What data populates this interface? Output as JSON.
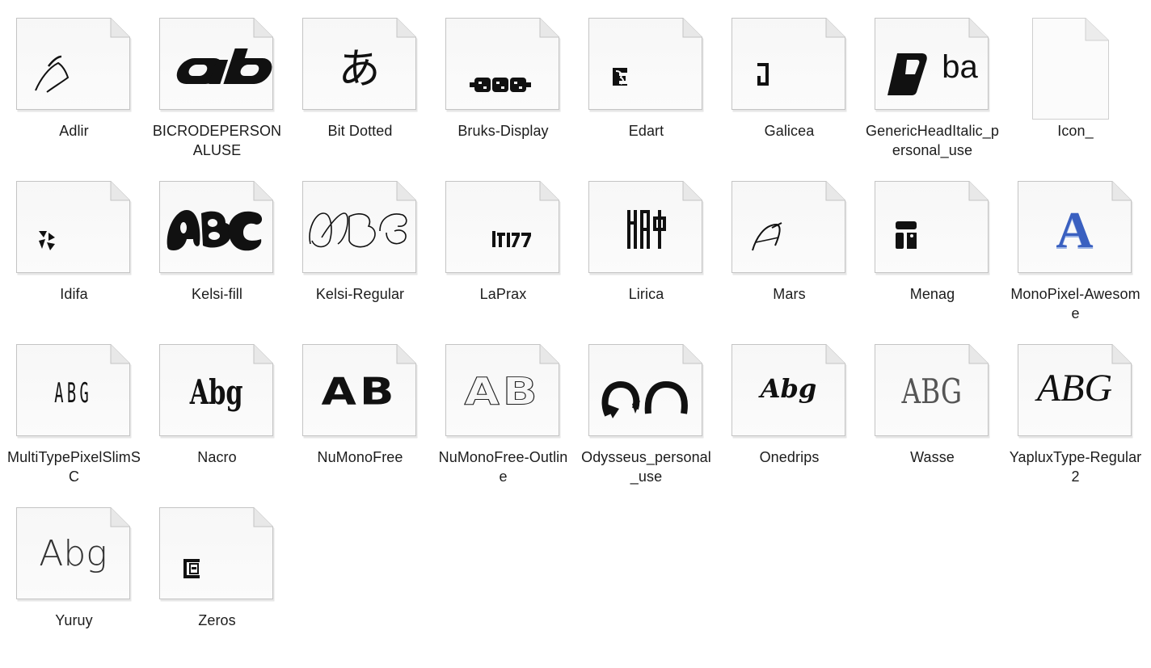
{
  "files": [
    {
      "name": "Adlir",
      "icon": "font-preview-adlir-icon"
    },
    {
      "name": "BICRODEPERSONALUSE",
      "icon": "font-preview-bicro-icon"
    },
    {
      "name": "Bit Dotted",
      "icon": "font-preview-bit-dotted-icon",
      "preview": "あ"
    },
    {
      "name": "Bruks-Display",
      "icon": "font-preview-bruks-icon"
    },
    {
      "name": "Edart",
      "icon": "font-preview-edart-icon"
    },
    {
      "name": "Galicea",
      "icon": "font-preview-galicea-icon"
    },
    {
      "name": "GenericHeadItalic_personal_use",
      "icon": "font-preview-generichead-icon",
      "preview": "ba"
    },
    {
      "name": "Icon_",
      "icon": "blank-document-icon"
    },
    {
      "name": "Idifa",
      "icon": "font-preview-idifa-icon"
    },
    {
      "name": "Kelsi-fill",
      "icon": "font-preview-kelsi-fill-icon"
    },
    {
      "name": "Kelsi-Regular",
      "icon": "font-preview-kelsi-regular-icon"
    },
    {
      "name": "LaPrax",
      "icon": "font-preview-laprax-icon"
    },
    {
      "name": "Lirica",
      "icon": "font-preview-lirica-icon"
    },
    {
      "name": "Mars",
      "icon": "font-preview-mars-icon"
    },
    {
      "name": "Menag",
      "icon": "font-preview-menag-icon"
    },
    {
      "name": "MonoPixel-Awesome",
      "icon": "font-preview-monopixel-icon",
      "preview": "A"
    },
    {
      "name": "MultiTypePixelSlimSC",
      "icon": "font-preview-multitype-icon",
      "preview": "ABG"
    },
    {
      "name": "Nacro",
      "icon": "font-preview-nacro-icon",
      "preview": "Abg"
    },
    {
      "name": "NuMonoFree",
      "icon": "font-preview-numono-icon",
      "preview": "AB"
    },
    {
      "name": "NuMonoFree-Outline",
      "icon": "font-preview-numono-outline-icon",
      "preview": "AB"
    },
    {
      "name": "Odysseus_personal_use",
      "icon": "font-preview-odysseus-icon"
    },
    {
      "name": "Onedrips",
      "icon": "font-preview-onedrips-icon",
      "preview": "Abg"
    },
    {
      "name": "Wasse",
      "icon": "font-preview-wasse-icon",
      "preview": "ABG"
    },
    {
      "name": "YapluxType-Regular 2",
      "icon": "font-preview-yaplux-icon",
      "preview": "ABG"
    },
    {
      "name": "Yuruy",
      "icon": "font-preview-yuruy-icon",
      "preview": "Abg"
    },
    {
      "name": "Zeros",
      "icon": "font-preview-zeros-icon"
    }
  ]
}
